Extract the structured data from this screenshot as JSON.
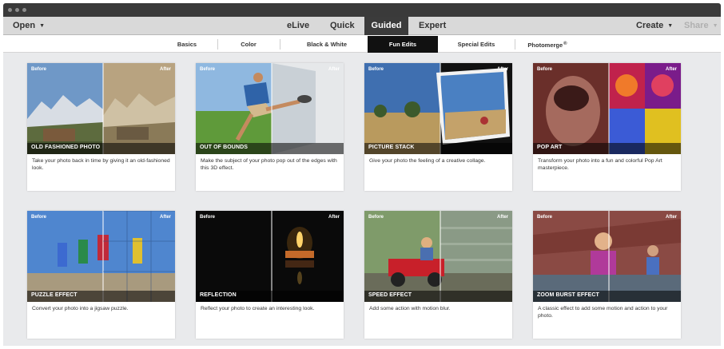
{
  "window": {
    "controls": [
      "close",
      "minimize",
      "zoom"
    ]
  },
  "menubar": {
    "open": "Open",
    "modes": [
      "eLive",
      "Quick",
      "Guided",
      "Expert"
    ],
    "selected_mode": "Guided",
    "create": "Create",
    "share": "Share"
  },
  "subtabs": {
    "items": [
      "Basics",
      "Color",
      "Black & White",
      "Fun Edits",
      "Special Edits",
      "Photomerge"
    ],
    "selected": "Fun Edits"
  },
  "labels": {
    "before": "Before",
    "after": "After"
  },
  "cards": [
    {
      "title": "OLD FASHIONED PHOTO",
      "description": "Take your photo back in time by giving it an old-fashioned look."
    },
    {
      "title": "OUT OF BOUNDS",
      "description": "Make the subject of your photo pop out of the edges with this 3D effect."
    },
    {
      "title": "PICTURE STACK",
      "description": "Give your photo the feeling of a creative collage."
    },
    {
      "title": "POP ART",
      "description": "Transform your photo into a fun and colorful Pop Art masterpiece."
    },
    {
      "title": "PUZZLE EFFECT",
      "description": "Convert your photo into a jigsaw puzzle."
    },
    {
      "title": "REFLECTION",
      "description": "Reflect your photo to create an interesting look."
    },
    {
      "title": "SPEED EFFECT",
      "description": "Add some action with motion blur."
    },
    {
      "title": "ZOOM BURST EFFECT",
      "description": "A classic effect to add some motion and action to your photo."
    }
  ]
}
